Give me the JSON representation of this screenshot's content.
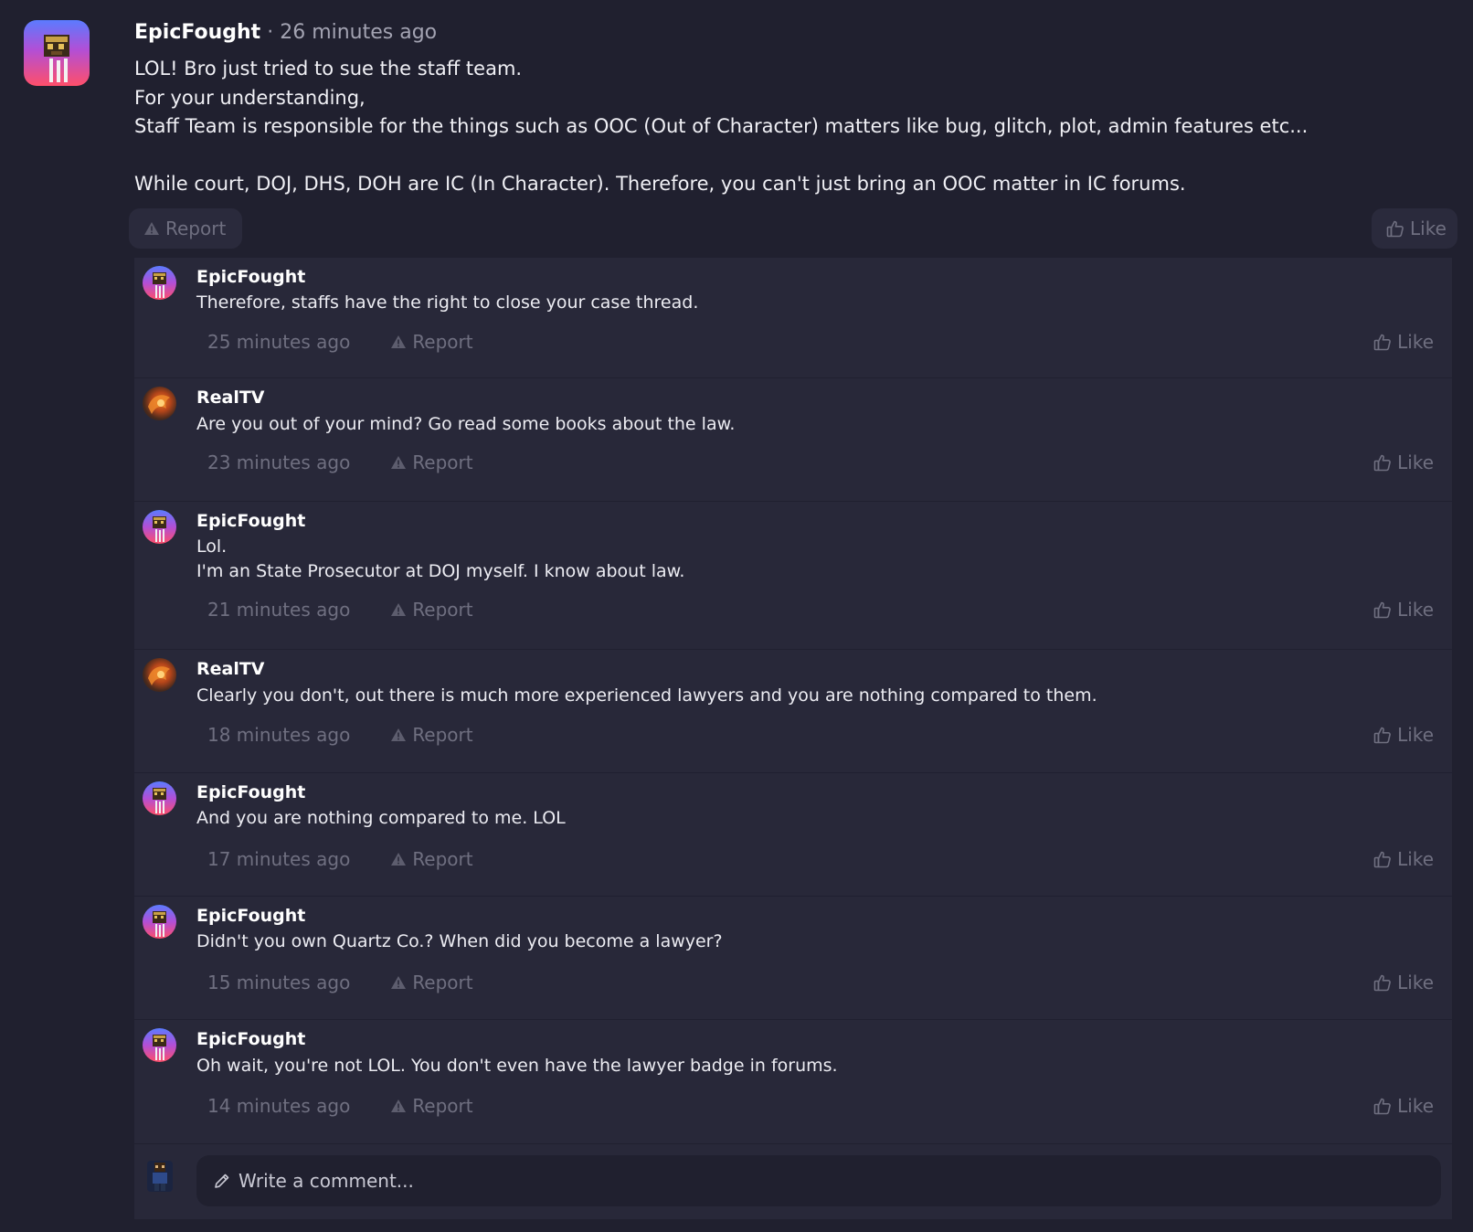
{
  "post": {
    "author": "EpicFought",
    "separator": "·",
    "time": "26 minutes ago",
    "lines": [
      "LOL! Bro just tried to sue the staff team.",
      "For your understanding,",
      "Staff Team is responsible for the things such as OOC (Out of Character) matters like bug, glitch, plot, admin features etc...",
      "",
      "While court, DOJ, DHS, DOH are IC (In Character). Therefore, you can't just bring an OOC matter in IC forums."
    ],
    "report_label": "Report",
    "like_label": "Like"
  },
  "comments": [
    {
      "author": "EpicFought",
      "avatar": "epicfought-avatar",
      "lines": [
        "Therefore, staffs have the right to close your case thread."
      ],
      "time": "25 minutes ago",
      "report_label": "Report",
      "like_label": "Like"
    },
    {
      "author": "RealTV",
      "avatar": "realtv-avatar",
      "lines": [
        "Are you out of your mind? Go read some books about the law."
      ],
      "time": "23 minutes ago",
      "report_label": "Report",
      "like_label": "Like"
    },
    {
      "author": "EpicFought",
      "avatar": "epicfought-avatar",
      "lines": [
        "Lol.",
        "I'm an State Prosecutor at DOJ myself. I know about law."
      ],
      "time": "21 minutes ago",
      "report_label": "Report",
      "like_label": "Like"
    },
    {
      "author": "RealTV",
      "avatar": "realtv-avatar",
      "lines": [
        "Clearly you don't, out there is much more experienced lawyers and you are nothing compared to them."
      ],
      "time": "18 minutes ago",
      "report_label": "Report",
      "like_label": "Like"
    },
    {
      "author": "EpicFought",
      "avatar": "epicfought-avatar",
      "lines": [
        "And you are nothing compared to me. LOL"
      ],
      "time": "17 minutes ago",
      "report_label": "Report",
      "like_label": "Like"
    },
    {
      "author": "EpicFought",
      "avatar": "epicfought-avatar",
      "lines": [
        "Didn't you own Quartz Co.? When did you become a lawyer?"
      ],
      "time": "15 minutes ago",
      "report_label": "Report",
      "like_label": "Like"
    },
    {
      "author": "EpicFought",
      "avatar": "epicfought-avatar",
      "lines": [
        "Oh wait, you're not LOL. You don't even have the lawyer badge in forums."
      ],
      "time": "14 minutes ago",
      "report_label": "Report",
      "like_label": "Like"
    }
  ],
  "composer": {
    "placeholder": "Write a comment..."
  },
  "colors": {
    "background": "#20202f",
    "panel": "#282839",
    "muted": "#6f6f80",
    "text": "#ececf2",
    "avatar_gradient_top": "#5b7bff",
    "avatar_gradient_bottom": "#ff4f6a"
  }
}
